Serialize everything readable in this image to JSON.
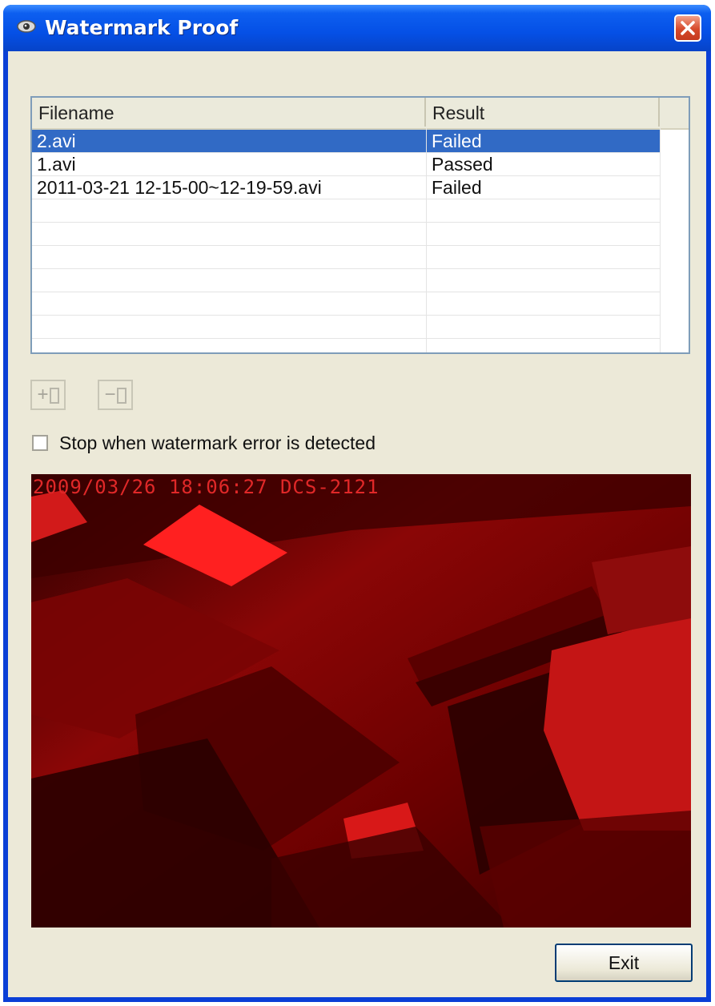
{
  "window": {
    "title": "Watermark Proof"
  },
  "file_list": {
    "columns": [
      "Filename",
      "Result"
    ],
    "rows": [
      {
        "filename": "2.avi",
        "result": "Failed",
        "selected": true
      },
      {
        "filename": "1.avi",
        "result": "Passed",
        "selected": false
      },
      {
        "filename": "2011-03-21 12-15-00~12-19-59.avi",
        "result": "Failed",
        "selected": false
      }
    ]
  },
  "toolbar": {
    "add_label": "+",
    "remove_label": "−"
  },
  "options": {
    "stop_on_error_label": "Stop when watermark error is detected",
    "stop_on_error_checked": false
  },
  "preview": {
    "osd_text": "2009/03/26 18:06:27 DCS-2121"
  },
  "footer": {
    "exit_label": "Exit"
  },
  "colors": {
    "title_bar": "#0550e6",
    "selection": "#316ac5",
    "close_button": "#d6492b",
    "video_tint": "#cc0000"
  }
}
